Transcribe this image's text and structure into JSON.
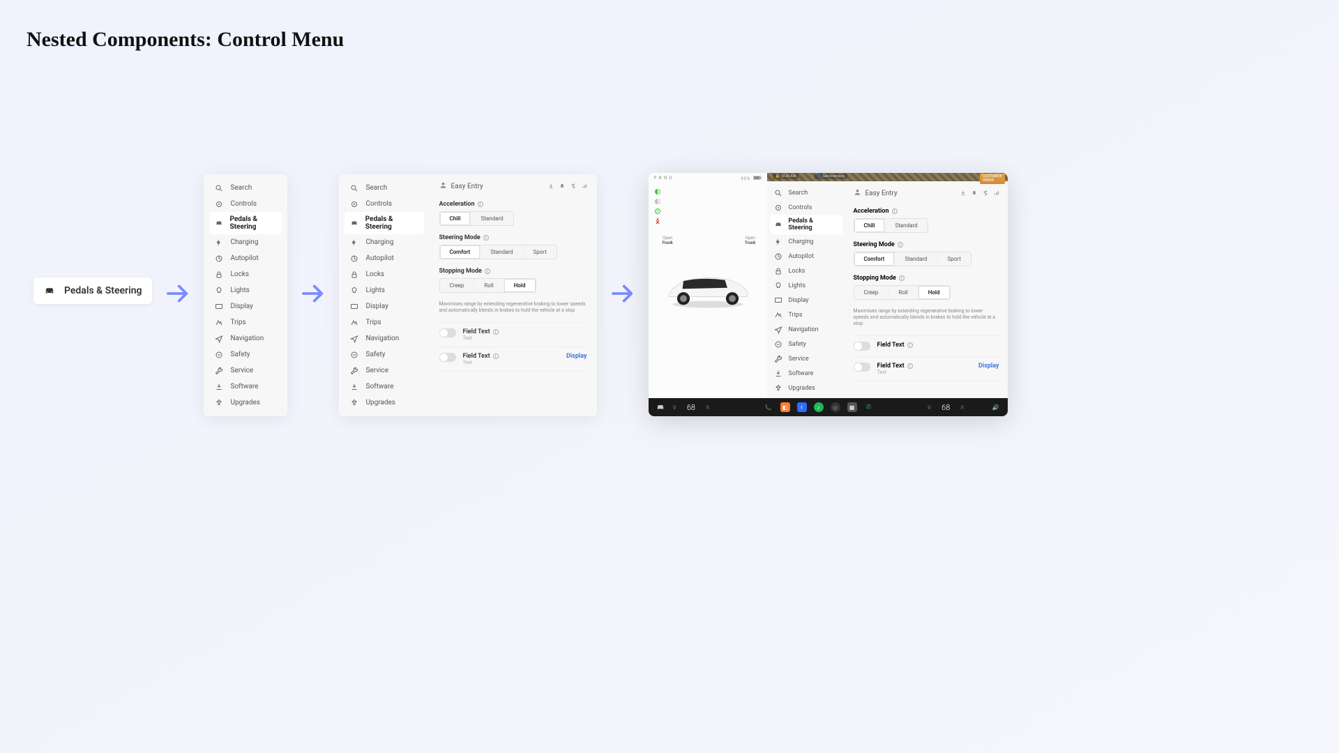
{
  "page": {
    "title": "Nested Components: Control Menu"
  },
  "stage1": {
    "label": "Pedals & Steering"
  },
  "sidebar": {
    "items": [
      {
        "key": "search",
        "label": "Search"
      },
      {
        "key": "controls",
        "label": "Controls"
      },
      {
        "key": "pedals",
        "label": "Pedals & Steering",
        "active": true
      },
      {
        "key": "charging",
        "label": "Charging"
      },
      {
        "key": "autopilot",
        "label": "Autopilot"
      },
      {
        "key": "locks",
        "label": "Locks"
      },
      {
        "key": "lights",
        "label": "Lights"
      },
      {
        "key": "display",
        "label": "Display"
      },
      {
        "key": "trips",
        "label": "Trips"
      },
      {
        "key": "navigation",
        "label": "Navigation"
      },
      {
        "key": "safety",
        "label": "Safety"
      },
      {
        "key": "service",
        "label": "Service"
      },
      {
        "key": "software",
        "label": "Software"
      },
      {
        "key": "upgrades",
        "label": "Upgrades"
      }
    ]
  },
  "panel": {
    "header": {
      "title": "Easy Entry"
    },
    "acceleration": {
      "label": "Acceleration",
      "options": [
        "Chill",
        "Standard"
      ],
      "selected": "Chill"
    },
    "steering": {
      "label": "Steering Mode",
      "options": [
        "Comfort",
        "Standard",
        "Sport"
      ],
      "selected": "Comfort"
    },
    "stopping": {
      "label": "Stopping Mode",
      "options": [
        "Creep",
        "Roll",
        "Hold"
      ],
      "selected": "Hold",
      "helper": "Maximises range by extending regenerative braking to lower speeds and automatically blends in brakes to hold the vehicle at a stop"
    },
    "toggle1": {
      "label": "Field Text",
      "sub": "Text"
    },
    "toggle2": {
      "label": "Field Text",
      "sub": "Text",
      "action": "Display"
    }
  },
  "device": {
    "top": {
      "gear": "P R N D",
      "battery": "90%"
    },
    "map": {
      "time": "10:20 AM",
      "location": "San Francisco"
    },
    "custom_tag": {
      "line1": "CUSTOMIZE",
      "line2": "ORDER"
    },
    "frunk": {
      "sub": "Open",
      "label": "Frunk"
    },
    "trunk": {
      "sub": "Open",
      "label": "Trunk"
    },
    "bar": {
      "temp_left": "68",
      "temp_right": "68"
    },
    "toggle_action": "Display"
  }
}
